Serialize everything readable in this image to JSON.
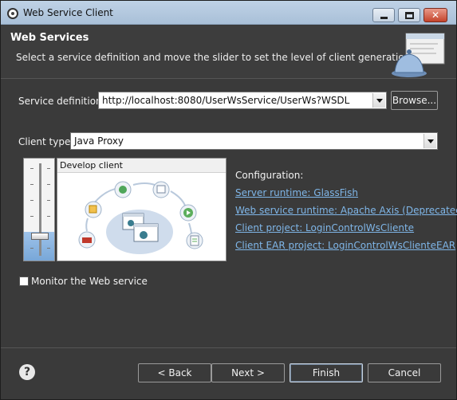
{
  "window": {
    "title": "Web Service Client"
  },
  "header": {
    "title": "Web Services",
    "description": "Select a service definition and move the slider to set the level of client generation."
  },
  "service_definition": {
    "label": "Service definition:",
    "value": "http://localhost:8080/UserWsService/UserWs?WSDL",
    "browse_label": "Browse..."
  },
  "client_type": {
    "label": "Client type:",
    "value": "Java Proxy"
  },
  "slider": {
    "stage_label": "Develop client",
    "level": "Develop client"
  },
  "configuration": {
    "title": "Configuration:",
    "links": [
      "Server runtime: GlassFish",
      "Web service runtime: Apache Axis (Deprecated)",
      "Client project: LoginControlWsCliente",
      "Client EAR project: LoginControlWsClienteEAR"
    ]
  },
  "monitor": {
    "label": "Monitor the Web service",
    "checked": false
  },
  "buttons": {
    "back": "< Back",
    "next": "Next >",
    "finish": "Finish",
    "cancel": "Cancel",
    "help": "?"
  },
  "colors": {
    "background": "#3a3a3a",
    "link": "#7fb6e8",
    "titlebar": "#bfd2e6"
  }
}
